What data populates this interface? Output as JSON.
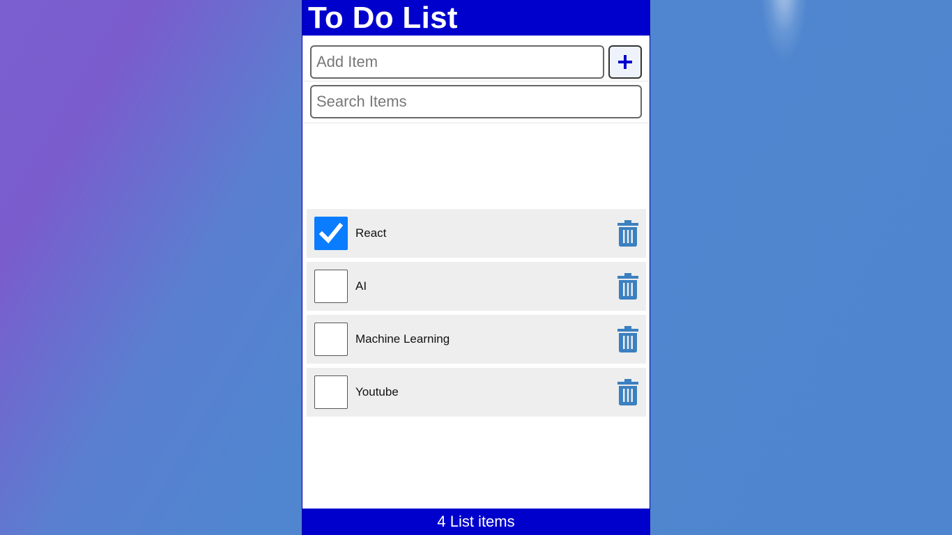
{
  "app": {
    "title": "To Do List"
  },
  "add_form": {
    "placeholder": "Add Item",
    "value": "",
    "button_icon": "plus-icon"
  },
  "search": {
    "placeholder": "Search Items",
    "value": ""
  },
  "items": [
    {
      "label": "React",
      "checked": true
    },
    {
      "label": "AI",
      "checked": false
    },
    {
      "label": "Machine Learning",
      "checked": false
    },
    {
      "label": "Youtube",
      "checked": false
    }
  ],
  "footer": {
    "text": "4 List items"
  },
  "colors": {
    "header_bg": "#0000cc",
    "checkbox_checked": "#0a7cff",
    "trash_icon": "#3b80c0",
    "item_bg": "#eeeeee"
  }
}
